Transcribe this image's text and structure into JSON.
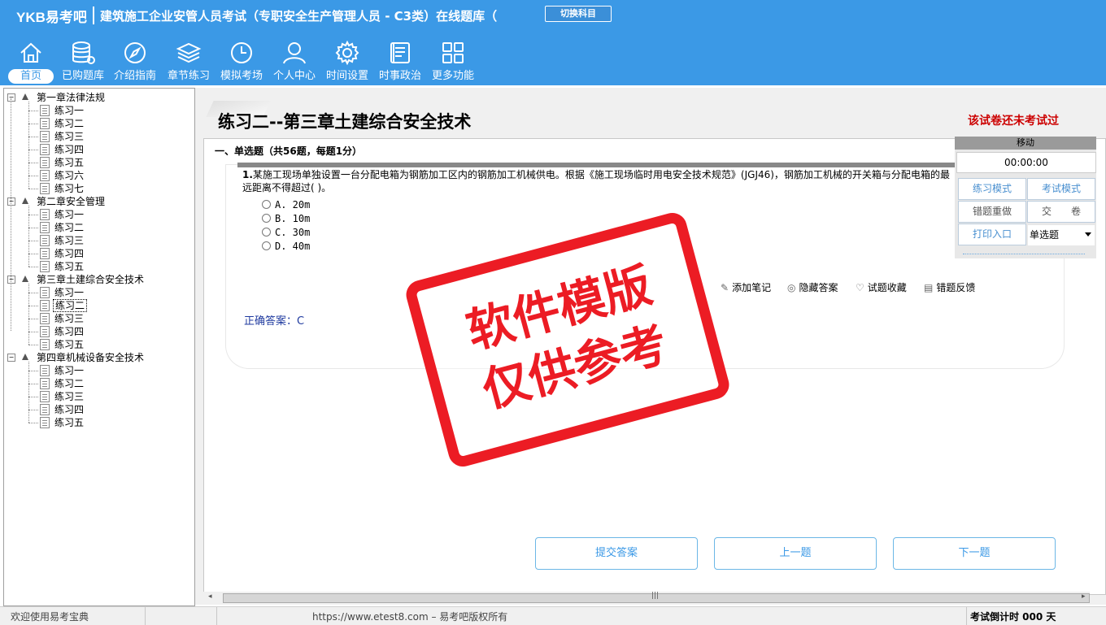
{
  "header": {
    "logo": "YKB易考吧",
    "title": "建筑施工企业安管人员考试（专职安全生产管理人员 - C3类）在线题库（",
    "switch_label": "切换科目"
  },
  "nav": {
    "items": [
      {
        "label": "首页",
        "icon": "home-icon"
      },
      {
        "label": "已购题库",
        "icon": "database-icon"
      },
      {
        "label": "介绍指南",
        "icon": "compass-icon"
      },
      {
        "label": "章节练习",
        "icon": "layers-icon"
      },
      {
        "label": "模拟考场",
        "icon": "clock-icon"
      },
      {
        "label": "个人中心",
        "icon": "user-icon"
      },
      {
        "label": "时间设置",
        "icon": "gear-icon"
      },
      {
        "label": "时事政治",
        "icon": "news-icon"
      },
      {
        "label": "更多功能",
        "icon": "grid-icon"
      }
    ]
  },
  "tree": {
    "chapters": [
      {
        "label": "第一章法律法规",
        "children": [
          "练习一",
          "练习二",
          "练习三",
          "练习四",
          "练习五",
          "练习六",
          "练习七"
        ]
      },
      {
        "label": "第二章安全管理",
        "children": [
          "练习一",
          "练习二",
          "练习三",
          "练习四",
          "练习五"
        ]
      },
      {
        "label": "第三章土建综合安全技术",
        "children": [
          "练习一",
          "练习二",
          "练习三",
          "练习四",
          "练习五"
        ]
      },
      {
        "label": "第四章机械设备安全技术",
        "children": [
          "练习一",
          "练习二",
          "练习三",
          "练习四",
          "练习五"
        ]
      }
    ]
  },
  "main": {
    "title": "练习二--第三章土建综合安全技术",
    "status": "该试卷还未考试过",
    "section": "一、单选题（共56题，每题1分）",
    "question": {
      "number": "1.",
      "text": "某施工现场单独设置一台分配电箱为钢筋加工区内的钢筋加工机械供电。根据《施工现场临时用电安全技术规范》(JGJ46)，钢筋加工机械的开关箱与分配电箱的最远距离不得超过( )。",
      "options": [
        "A. 20m",
        "B. 10m",
        "C. 30m",
        "D. 40m"
      ]
    },
    "tools": {
      "add_note": "添加笔记",
      "hide_answer": "隐藏答案",
      "favorite": "试题收藏",
      "feedback": "错题反馈"
    },
    "answer": "正确答案：C",
    "stamp": {
      "line1": "软件模版",
      "line2": "仅供参考"
    }
  },
  "panel": {
    "move": "移动",
    "timer": "00:00:00",
    "practice_mode": "练习模式",
    "exam_mode": "考试模式",
    "redo_wrong": "错题重做",
    "submit_paper": "交　　卷",
    "print": "打印入口",
    "type_select": "单选题"
  },
  "bottom": {
    "submit": "提交答案",
    "prev": "上一题",
    "next": "下一题"
  },
  "statusbar": {
    "welcome": "欢迎使用易考宝典",
    "copyright": "https://www.etest8.com – 易考吧版权所有",
    "countdown": "考试倒计时 000 天"
  },
  "colors": {
    "header_bg": "#3b99e6",
    "stamp_red": "#ec1c24",
    "status_red": "#cc0000",
    "answer_blue": "#1f3a9f"
  }
}
